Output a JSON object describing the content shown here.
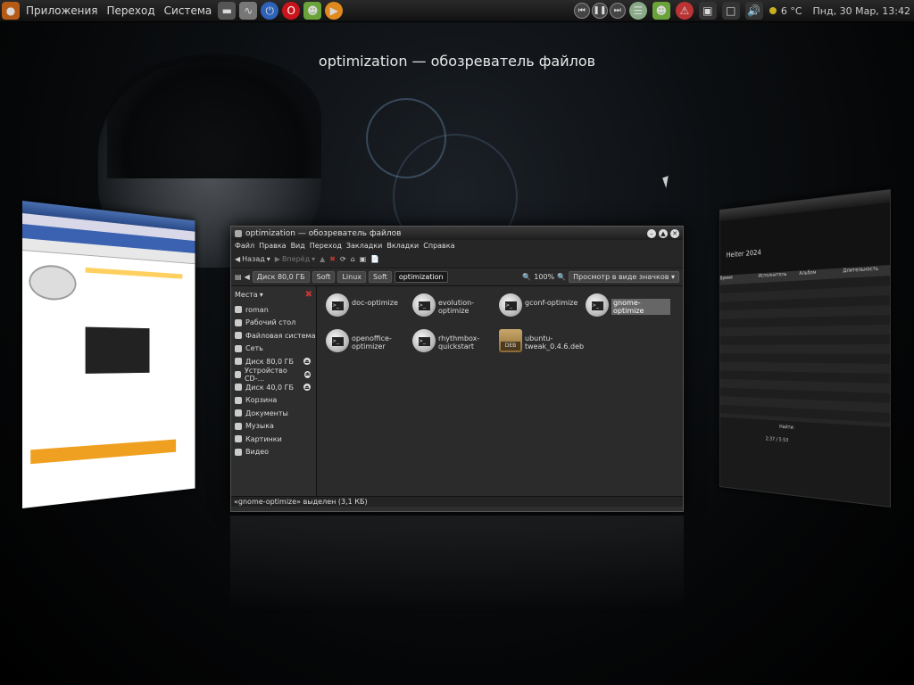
{
  "panel": {
    "menus": [
      "Приложения",
      "Переход",
      "Система"
    ],
    "weather": "6 °C",
    "datetime": "Пнд, 30 Мар, 13:42"
  },
  "switcher_title": "optimization — обозреватель файлов",
  "nautilus": {
    "title": "optimization — обозреватель файлов",
    "menu": [
      "Файл",
      "Правка",
      "Вид",
      "Переход",
      "Закладки",
      "Вкладки",
      "Справка"
    ],
    "toolbar": {
      "back": "Назад",
      "forward": "Вперёд"
    },
    "location": {
      "crumbs": [
        "Диск 80,0 ГБ",
        "Soft",
        "Linux",
        "Soft",
        "optimization"
      ],
      "zoom": "100%",
      "view_mode": "Просмотр в виде значков"
    },
    "sidebar": {
      "header": "Места",
      "items": [
        {
          "label": "roman",
          "eject": false
        },
        {
          "label": "Рабочий стол",
          "eject": false
        },
        {
          "label": "Файловая система",
          "eject": false
        },
        {
          "label": "Сеть",
          "eject": false
        },
        {
          "label": "Диск 80,0 ГБ",
          "eject": true
        },
        {
          "label": "Устройство CD-...",
          "eject": true
        },
        {
          "label": "Диск 40,0 ГБ",
          "eject": true
        },
        {
          "label": "Корзина",
          "eject": false
        },
        {
          "label": "Документы",
          "eject": false
        },
        {
          "label": "Музыка",
          "eject": false
        },
        {
          "label": "Картинки",
          "eject": false
        },
        {
          "label": "Видео",
          "eject": false
        }
      ]
    },
    "files": [
      {
        "name": "doc-optimize",
        "type": "script",
        "selected": false
      },
      {
        "name": "evolution-optimize",
        "type": "script",
        "selected": false
      },
      {
        "name": "gconf-optimize",
        "type": "script",
        "selected": false
      },
      {
        "name": "gnome-optimize",
        "type": "script",
        "selected": true
      },
      {
        "name": "openoffice-optimizer",
        "type": "script",
        "selected": false
      },
      {
        "name": "rhythmbox-quickstart",
        "type": "script",
        "selected": false
      },
      {
        "name": "ubuntu-tweak_0.4.6.deb",
        "type": "deb",
        "selected": false
      }
    ],
    "status": "«gnome-optimize» выделен (3,1 КБ)"
  },
  "right_window": {
    "now_playing": "Heiter 2024",
    "columns": [
      "Время",
      "Исполнитель",
      "Альбом",
      "Длительность"
    ],
    "search_label": "Найти:",
    "elapsed": "2:37 / 5:53"
  }
}
